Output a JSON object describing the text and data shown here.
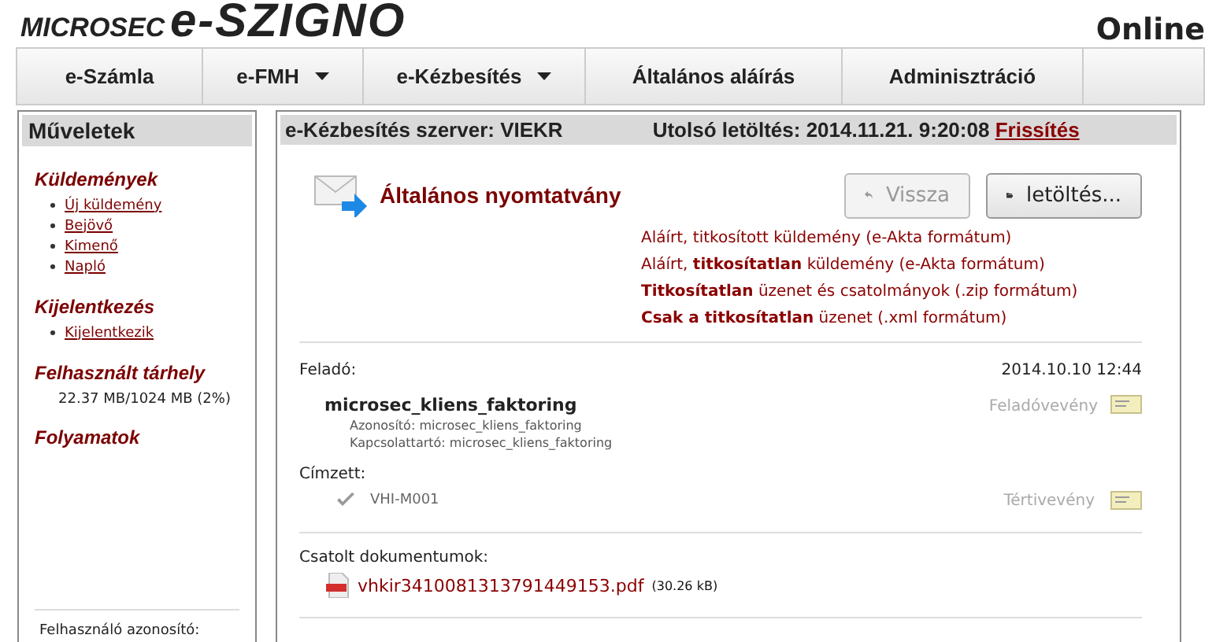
{
  "logo": {
    "brand": "MICROSEC",
    "product": "e-SZIGNO"
  },
  "status": "Online",
  "nav": [
    {
      "label": "e-Számla",
      "has_menu": false
    },
    {
      "label": "e-FMH",
      "has_menu": true
    },
    {
      "label": "e-Kézbesítés",
      "has_menu": true
    },
    {
      "label": "Általános aláírás",
      "has_menu": false
    },
    {
      "label": "Adminisztráció",
      "has_menu": false
    }
  ],
  "sidebar": {
    "title": "Műveletek",
    "sections": [
      {
        "heading": "Küldemények",
        "links": [
          "Új küldemény",
          "Bejövő",
          "Kimenő",
          "Napló"
        ]
      },
      {
        "heading": "Kijelentkezés",
        "links": [
          "Kijelentkezik"
        ]
      },
      {
        "heading": "Felhasznált tárhely",
        "text": "22.37 MB/1024 MB (2%)"
      },
      {
        "heading": "Folyamatok"
      }
    ],
    "footer": "Felhasználó azonosító:"
  },
  "main": {
    "server": "e-Kézbesítés szerver: VIEKR",
    "last_download": "Utolsó letöltés: 2014.11.21. 9:20:08",
    "refresh": "Frissítés",
    "title": "Általános nyomtatvány",
    "back_button": "Vissza",
    "download_button": "letöltés...",
    "download_options": [
      "Aláírt, titkosított küldemény (e-Akta formátum)",
      "Aláírt, **titkosítatlan** küldemény (e-Akta formátum)",
      "**Titkosítatlan** üzenet és csatolmányok (.zip formátum)",
      "**Csak a titkosítatlan** üzenet (.xml formátum)"
    ],
    "sender_label": "Feladó:",
    "date": "2014.10.10 12:44",
    "sender_name": "microsec_kliens_faktoring",
    "sender_id": "Azonosító: microsec_kliens_faktoring",
    "sender_contact": "Kapcsolattartó: microsec_kliens_faktoring",
    "sender_receipt": "Feladóvevény",
    "recipient_label": "Címzett:",
    "recipient": "VHI-M001",
    "recipient_receipt": "Tértivevény",
    "attachments_label": "Csatolt dokumentumok:",
    "attachment": {
      "name": "vhkir3410081313791449153.pdf",
      "size": "(30.26 kB)"
    }
  }
}
